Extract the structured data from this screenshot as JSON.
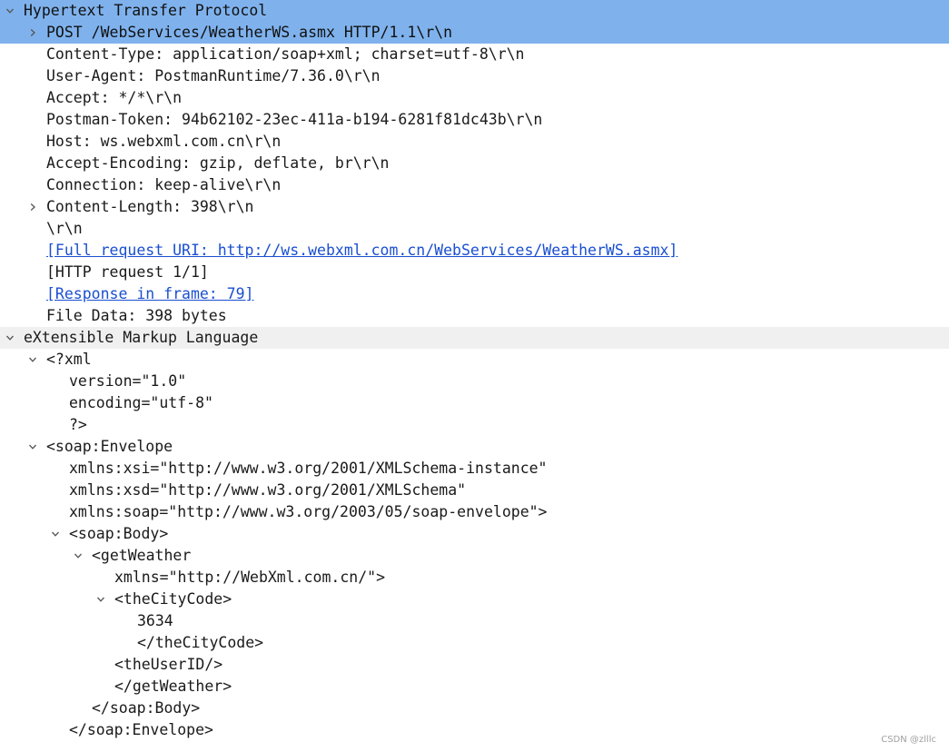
{
  "tree": [
    {
      "depth": 0,
      "toggle": "open",
      "text": "Hypertext Transfer Protocol",
      "style": "selected"
    },
    {
      "depth": 1,
      "toggle": "closed",
      "text": "POST /WebServices/WeatherWS.asmx HTTP/1.1\\r\\n",
      "style": "selected"
    },
    {
      "depth": 1,
      "toggle": "none",
      "text": "Content-Type: application/soap+xml; charset=utf-8\\r\\n"
    },
    {
      "depth": 1,
      "toggle": "none",
      "text": "User-Agent: PostmanRuntime/7.36.0\\r\\n"
    },
    {
      "depth": 1,
      "toggle": "none",
      "text": "Accept: */*\\r\\n"
    },
    {
      "depth": 1,
      "toggle": "none",
      "text": "Postman-Token: 94b62102-23ec-411a-b194-6281f81dc43b\\r\\n"
    },
    {
      "depth": 1,
      "toggle": "none",
      "text": "Host: ws.webxml.com.cn\\r\\n"
    },
    {
      "depth": 1,
      "toggle": "none",
      "text": "Accept-Encoding: gzip, deflate, br\\r\\n"
    },
    {
      "depth": 1,
      "toggle": "none",
      "text": "Connection: keep-alive\\r\\n"
    },
    {
      "depth": 1,
      "toggle": "closed",
      "text": "Content-Length: 398\\r\\n"
    },
    {
      "depth": 1,
      "toggle": "none",
      "text": "\\r\\n"
    },
    {
      "depth": 1,
      "toggle": "none",
      "text": "[Full request URI: http://ws.webxml.com.cn/WebServices/WeatherWS.asmx]",
      "style": "link"
    },
    {
      "depth": 1,
      "toggle": "none",
      "text": "[HTTP request 1/1]"
    },
    {
      "depth": 1,
      "toggle": "none",
      "text": "[Response in frame: 79]",
      "style": "link"
    },
    {
      "depth": 1,
      "toggle": "none",
      "text": "File Data: 398 bytes"
    },
    {
      "depth": 0,
      "toggle": "open",
      "text": "eXtensible Markup Language",
      "style": "band"
    },
    {
      "depth": 1,
      "toggle": "open",
      "text": "<?xml"
    },
    {
      "depth": 2,
      "toggle": "none",
      "text": "version=\"1.0\""
    },
    {
      "depth": 2,
      "toggle": "none",
      "text": "encoding=\"utf-8\""
    },
    {
      "depth": 2,
      "toggle": "none",
      "text": "?>"
    },
    {
      "depth": 1,
      "toggle": "open",
      "text": "<soap:Envelope"
    },
    {
      "depth": 2,
      "toggle": "none",
      "text": "xmlns:xsi=\"http://www.w3.org/2001/XMLSchema-instance\""
    },
    {
      "depth": 2,
      "toggle": "none",
      "text": "xmlns:xsd=\"http://www.w3.org/2001/XMLSchema\""
    },
    {
      "depth": 2,
      "toggle": "none",
      "text": "xmlns:soap=\"http://www.w3.org/2003/05/soap-envelope\">"
    },
    {
      "depth": 2,
      "toggle": "open",
      "text": "<soap:Body>"
    },
    {
      "depth": 3,
      "toggle": "open",
      "text": "<getWeather"
    },
    {
      "depth": 4,
      "toggle": "none",
      "text": "xmlns=\"http://WebXml.com.cn/\">"
    },
    {
      "depth": 4,
      "toggle": "open",
      "text": "<theCityCode>"
    },
    {
      "depth": 5,
      "toggle": "none",
      "text": "3634"
    },
    {
      "depth": 5,
      "toggle": "none",
      "text": "</theCityCode>"
    },
    {
      "depth": 4,
      "toggle": "none",
      "text": "<theUserID/>"
    },
    {
      "depth": 4,
      "toggle": "none",
      "text": "</getWeather>"
    },
    {
      "depth": 3,
      "toggle": "none",
      "text": "</soap:Body>"
    },
    {
      "depth": 2,
      "toggle": "none",
      "text": "</soap:Envelope>"
    }
  ],
  "icons": {
    "open": "chevron-down-icon",
    "closed": "chevron-right-icon"
  },
  "colors": {
    "selection": "#7fb2ed",
    "band": "#f0f0f0",
    "link": "#1a4fd0"
  },
  "watermark": "CSDN @zlllc"
}
